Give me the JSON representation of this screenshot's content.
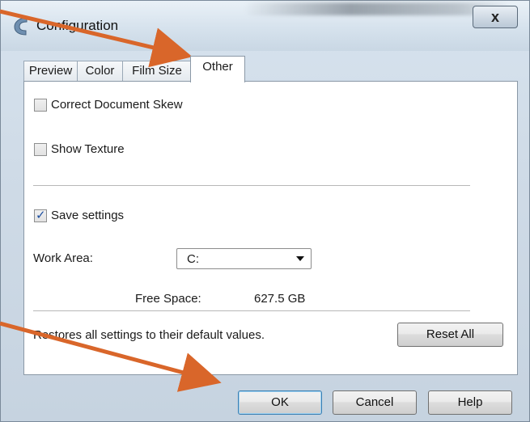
{
  "window": {
    "title": "Configuration",
    "close_glyph": "x"
  },
  "tabs": [
    {
      "label": "Preview",
      "active": false
    },
    {
      "label": "Color",
      "active": false
    },
    {
      "label": "Film Size",
      "active": false
    },
    {
      "label": "Other",
      "active": true
    }
  ],
  "options": {
    "correct_skew": {
      "label": "Correct Document Skew",
      "checked": false
    },
    "show_texture": {
      "label": "Show Texture",
      "checked": false
    },
    "save_settings": {
      "label": "Save settings",
      "checked": true
    }
  },
  "work_area": {
    "label": "Work Area:",
    "selected": "C:",
    "free_space_label": "Free Space:",
    "free_space_value": "627.5 GB"
  },
  "reset": {
    "description": "Restores all settings to their default values.",
    "button_label": "Reset All"
  },
  "footer": {
    "ok_label": "OK",
    "cancel_label": "Cancel",
    "help_label": "Help"
  },
  "colors": {
    "annotation_arrow": "#d9662a",
    "checkmark": "#1d4fa0"
  },
  "icons": {
    "app": "app-logo-icon",
    "close": "close-icon",
    "check": "checkmark-icon",
    "dropdown": "chevron-down-icon"
  }
}
